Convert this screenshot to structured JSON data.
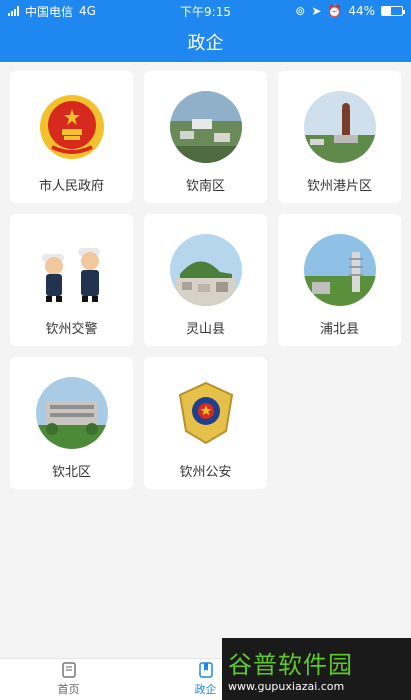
{
  "status_bar": {
    "carrier": "中国电信",
    "network": "4G",
    "time": "下午9:15",
    "battery": "44%"
  },
  "header": {
    "title": "政企"
  },
  "cards": [
    {
      "label": "市人民政府",
      "icon": "national-emblem-icon"
    },
    {
      "label": "钦南区",
      "icon": "city-photo"
    },
    {
      "label": "钦州港片区",
      "icon": "statue-photo"
    },
    {
      "label": "钦州交警",
      "icon": "traffic-police-cartoon"
    },
    {
      "label": "灵山县",
      "icon": "town-photo"
    },
    {
      "label": "浦北县",
      "icon": "pagoda-photo"
    },
    {
      "label": "钦北区",
      "icon": "building-photo"
    },
    {
      "label": "钦州公安",
      "icon": "police-badge-icon"
    }
  ],
  "tabbar": {
    "items": [
      {
        "label": "首页",
        "icon": "document-icon",
        "active": false
      },
      {
        "label": "政企",
        "icon": "book-icon",
        "active": true
      }
    ]
  },
  "watermark": {
    "brand": "谷普软件园",
    "url": "www.gupuxiazai.com"
  },
  "colors": {
    "primary": "#1e88f0",
    "background": "#f4f4f4",
    "card": "#ffffff"
  }
}
